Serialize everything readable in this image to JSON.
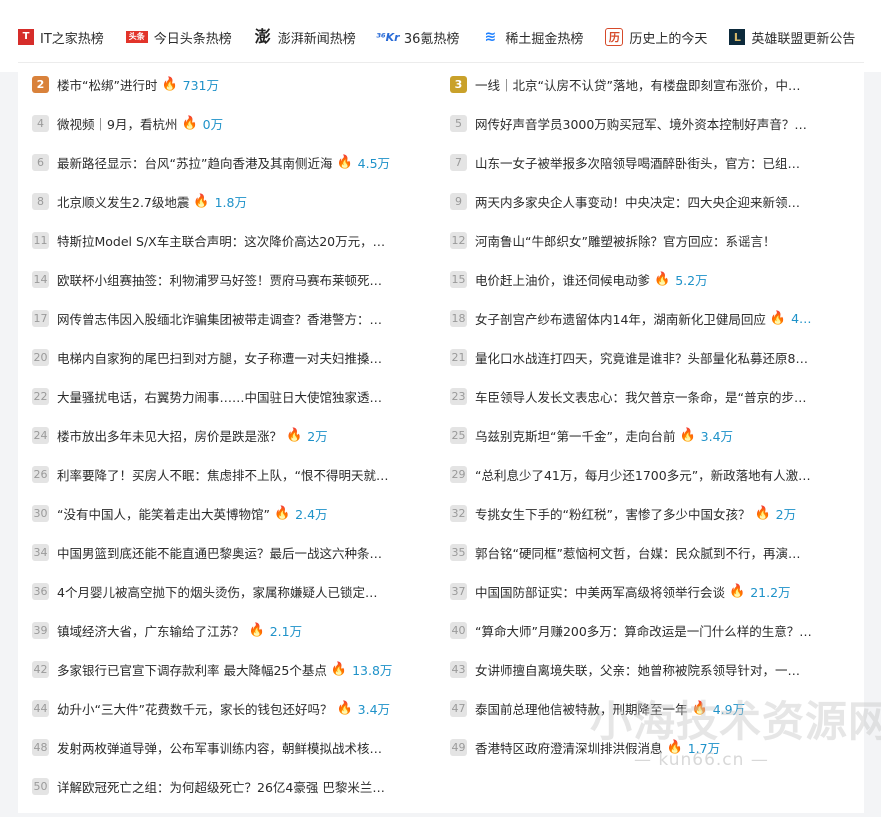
{
  "tabs": [
    {
      "label": "IT之家热榜",
      "icon": "ithome-icon",
      "glyph": "T"
    },
    {
      "label": "今日头条热榜",
      "icon": "toutiao-icon",
      "glyph": "头条"
    },
    {
      "label": "澎湃新闻热榜",
      "icon": "thepaper-icon",
      "glyph": "澎"
    },
    {
      "label": "36氪热榜",
      "icon": "36kr-icon",
      "glyph": "³⁶Kr"
    },
    {
      "label": "稀土掘金热榜",
      "icon": "juejin-icon",
      "glyph": "≋"
    },
    {
      "label": "历史上的今天",
      "icon": "history-icon",
      "glyph": "历"
    },
    {
      "label": "英雄联盟更新公告",
      "icon": "lol-icon",
      "glyph": "L"
    }
  ],
  "colors": {
    "rank2": "#d9823b",
    "rank3": "#c9a12a",
    "heat": "#1f92c9",
    "flame": "#e0413a"
  },
  "left_items": [
    {
      "rank": "2",
      "title": "楼市“松绑”进行时",
      "heat": "731万"
    },
    {
      "rank": "4",
      "title": "微视频｜9月，看杭州",
      "heat": "0万"
    },
    {
      "rank": "6",
      "title": "最新路径显示：台风“苏拉”趋向香港及其南侧近海",
      "heat": "4.5万"
    },
    {
      "rank": "8",
      "title": "北京顺义发生2.7级地震",
      "heat": "1.8万"
    },
    {
      "rank": "11",
      "title": "特斯拉Model S/X车主联合声明：这次降价高达20万元，…",
      "heat": ""
    },
    {
      "rank": "14",
      "title": "欧联杯小组赛抽签：利物浦罗马好签！贾府马赛布莱顿死…",
      "heat": ""
    },
    {
      "rank": "17",
      "title": "网传曾志伟因入股缅北诈骗集团被带走调查？香港警方：…",
      "heat": ""
    },
    {
      "rank": "20",
      "title": "电梯内自家狗的尾巴扫到对方腿，女子称遭一对夫妇推搡…",
      "heat": ""
    },
    {
      "rank": "22",
      "title": "大量骚扰电话，右翼势力闹事……中国驻日大使馆独家透…",
      "heat": ""
    },
    {
      "rank": "24",
      "title": "楼市放出多年未见大招，房价是跌是涨？",
      "heat": "2万"
    },
    {
      "rank": "26",
      "title": "利率要降了！买房人不眠：焦虑排不上队，“恨不得明天就…",
      "heat": ""
    },
    {
      "rank": "30",
      "title": "“没有中国人，能笑着走出大英博物馆”",
      "heat": "2.4万"
    },
    {
      "rank": "34",
      "title": "中国男篮到底还能不能直通巴黎奥运？最后一战这六种条…",
      "heat": ""
    },
    {
      "rank": "36",
      "title": "4个月婴儿被高空抛下的烟头烫伤，家属称嫌疑人已锁定…",
      "heat": ""
    },
    {
      "rank": "39",
      "title": "镇域经济大省，广东输给了江苏？",
      "heat": "2.1万"
    },
    {
      "rank": "42",
      "title": "多家银行已官宣下调存款利率 最大降幅25个基点",
      "heat": "13.8万"
    },
    {
      "rank": "44",
      "title": "幼升小“三大件”花费数千元，家长的钱包还好吗？",
      "heat": "3.4万"
    },
    {
      "rank": "48",
      "title": "发射两枚弹道导弹，公布军事训练内容，朝鲜模拟战术核…",
      "heat": ""
    },
    {
      "rank": "50",
      "title": "详解欧冠死亡之组：为何超级死亡？26亿4豪强 巴黎米兰…",
      "heat": ""
    }
  ],
  "right_items": [
    {
      "rank": "3",
      "title": "一线｜北京“认房不认贷”落地，有楼盘即刻宣布涨价，中…",
      "heat": ""
    },
    {
      "rank": "5",
      "title": "网传好声音学员3000万购买冠军、境外资本控制好声音？…",
      "heat": ""
    },
    {
      "rank": "7",
      "title": "山东一女子被举报多次陪领导喝酒醉卧街头，官方：已组…",
      "heat": ""
    },
    {
      "rank": "9",
      "title": "两天内多家央企人事变动！中央决定：四大央企迎来新领…",
      "heat": ""
    },
    {
      "rank": "12",
      "title": "河南鲁山“牛郎织女”雕塑被拆除？官方回应：系谣言！",
      "heat": ""
    },
    {
      "rank": "15",
      "title": "电价赶上油价，谁还伺候电动爹",
      "heat": "5.2万"
    },
    {
      "rank": "18",
      "title": "女子剖宫产纱布遗留体内14年，湖南新化卫健局回应",
      "heat": "4…"
    },
    {
      "rank": "21",
      "title": "量化口水战连打四天，究竟谁是谁非？头部量化私募还原8…",
      "heat": ""
    },
    {
      "rank": "23",
      "title": "车臣领导人发长文表忠心：我欠普京一条命，是“普京的步…",
      "heat": ""
    },
    {
      "rank": "25",
      "title": "乌兹别克斯坦“第一千金”，走向台前",
      "heat": "3.4万"
    },
    {
      "rank": "29",
      "title": "“总利息少了41万，每月少还1700多元”，新政落地有人激…",
      "heat": ""
    },
    {
      "rank": "32",
      "title": "专挑女生下手的“粉红税”，害惨了多少中国女孩？",
      "heat": "2万"
    },
    {
      "rank": "35",
      "title": "郭台铭“硬同框”惹恼柯文哲，台媒：民众腻到不行，再演…",
      "heat": ""
    },
    {
      "rank": "37",
      "title": "中国国防部证实：中美两军高级将领举行会谈",
      "heat": "21.2万"
    },
    {
      "rank": "40",
      "title": "“算命大师”月赚200多万：算命改运是一门什么样的生意？…",
      "heat": ""
    },
    {
      "rank": "43",
      "title": "女讲师擅自离境失联，父亲：她曾称被院系领导针对，一…",
      "heat": ""
    },
    {
      "rank": "47",
      "title": "泰国前总理他信被特赦，刑期降至一年",
      "heat": "4.9万"
    },
    {
      "rank": "49",
      "title": "香港特区政府澄清深圳排洪假消息",
      "heat": "1.7万"
    }
  ],
  "watermark": {
    "main": "小海技术资源网",
    "sub": "— kun66.cn —"
  }
}
